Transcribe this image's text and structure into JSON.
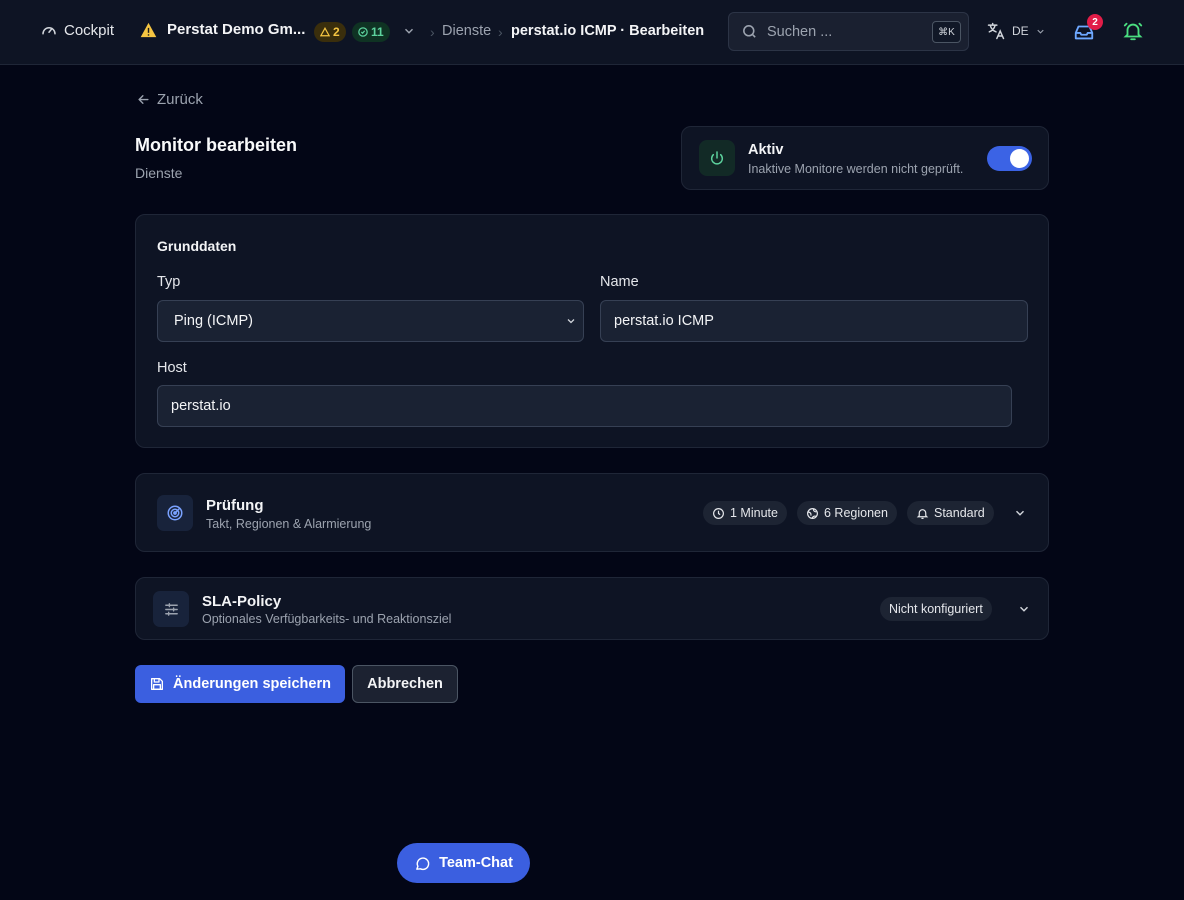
{
  "topbar": {
    "cockpit_label": "Cockpit",
    "org_name": "Perstat Demo Gm...",
    "warn_count": "2",
    "ok_count": "11",
    "breadcrumb": [
      "Dienste",
      "perstat.io ICMP · Bearbeiten"
    ],
    "search_placeholder": "Suchen ...",
    "search_shortcut": "⌘K",
    "language": "DE",
    "inbox_badge": "2"
  },
  "back_label": "Zurück",
  "page": {
    "title": "Monitor bearbeiten",
    "subtitle": "Dienste"
  },
  "active_card": {
    "title": "Aktiv",
    "description": "Inaktive Monitore werden nicht geprüft.",
    "enabled": true
  },
  "grunddaten": {
    "title": "Grunddaten",
    "type_label": "Typ",
    "type_value": "Ping (ICMP)",
    "name_label": "Name",
    "name_value": "perstat.io ICMP",
    "host_label": "Host",
    "host_value": "perstat.io"
  },
  "pruefung": {
    "title": "Prüfung",
    "description": "Takt, Regionen & Alarmierung",
    "chips": [
      "1 Minute",
      "6 Regionen",
      "Standard"
    ]
  },
  "sla": {
    "title": "SLA-Policy",
    "description": "Optionales Verfügbarkeits- und Reaktionsziel",
    "chip": "Nicht konfiguriert"
  },
  "actions": {
    "save_label": "Änderungen speichern",
    "cancel_label": "Abbrechen"
  },
  "chat_label": "Team-Chat",
  "colors": {
    "background": "#030616",
    "card": "#0e1424",
    "accent": "#3b5fe0",
    "warning": "#f5c542",
    "success": "#5dd39e",
    "badge": "#e11d48"
  }
}
